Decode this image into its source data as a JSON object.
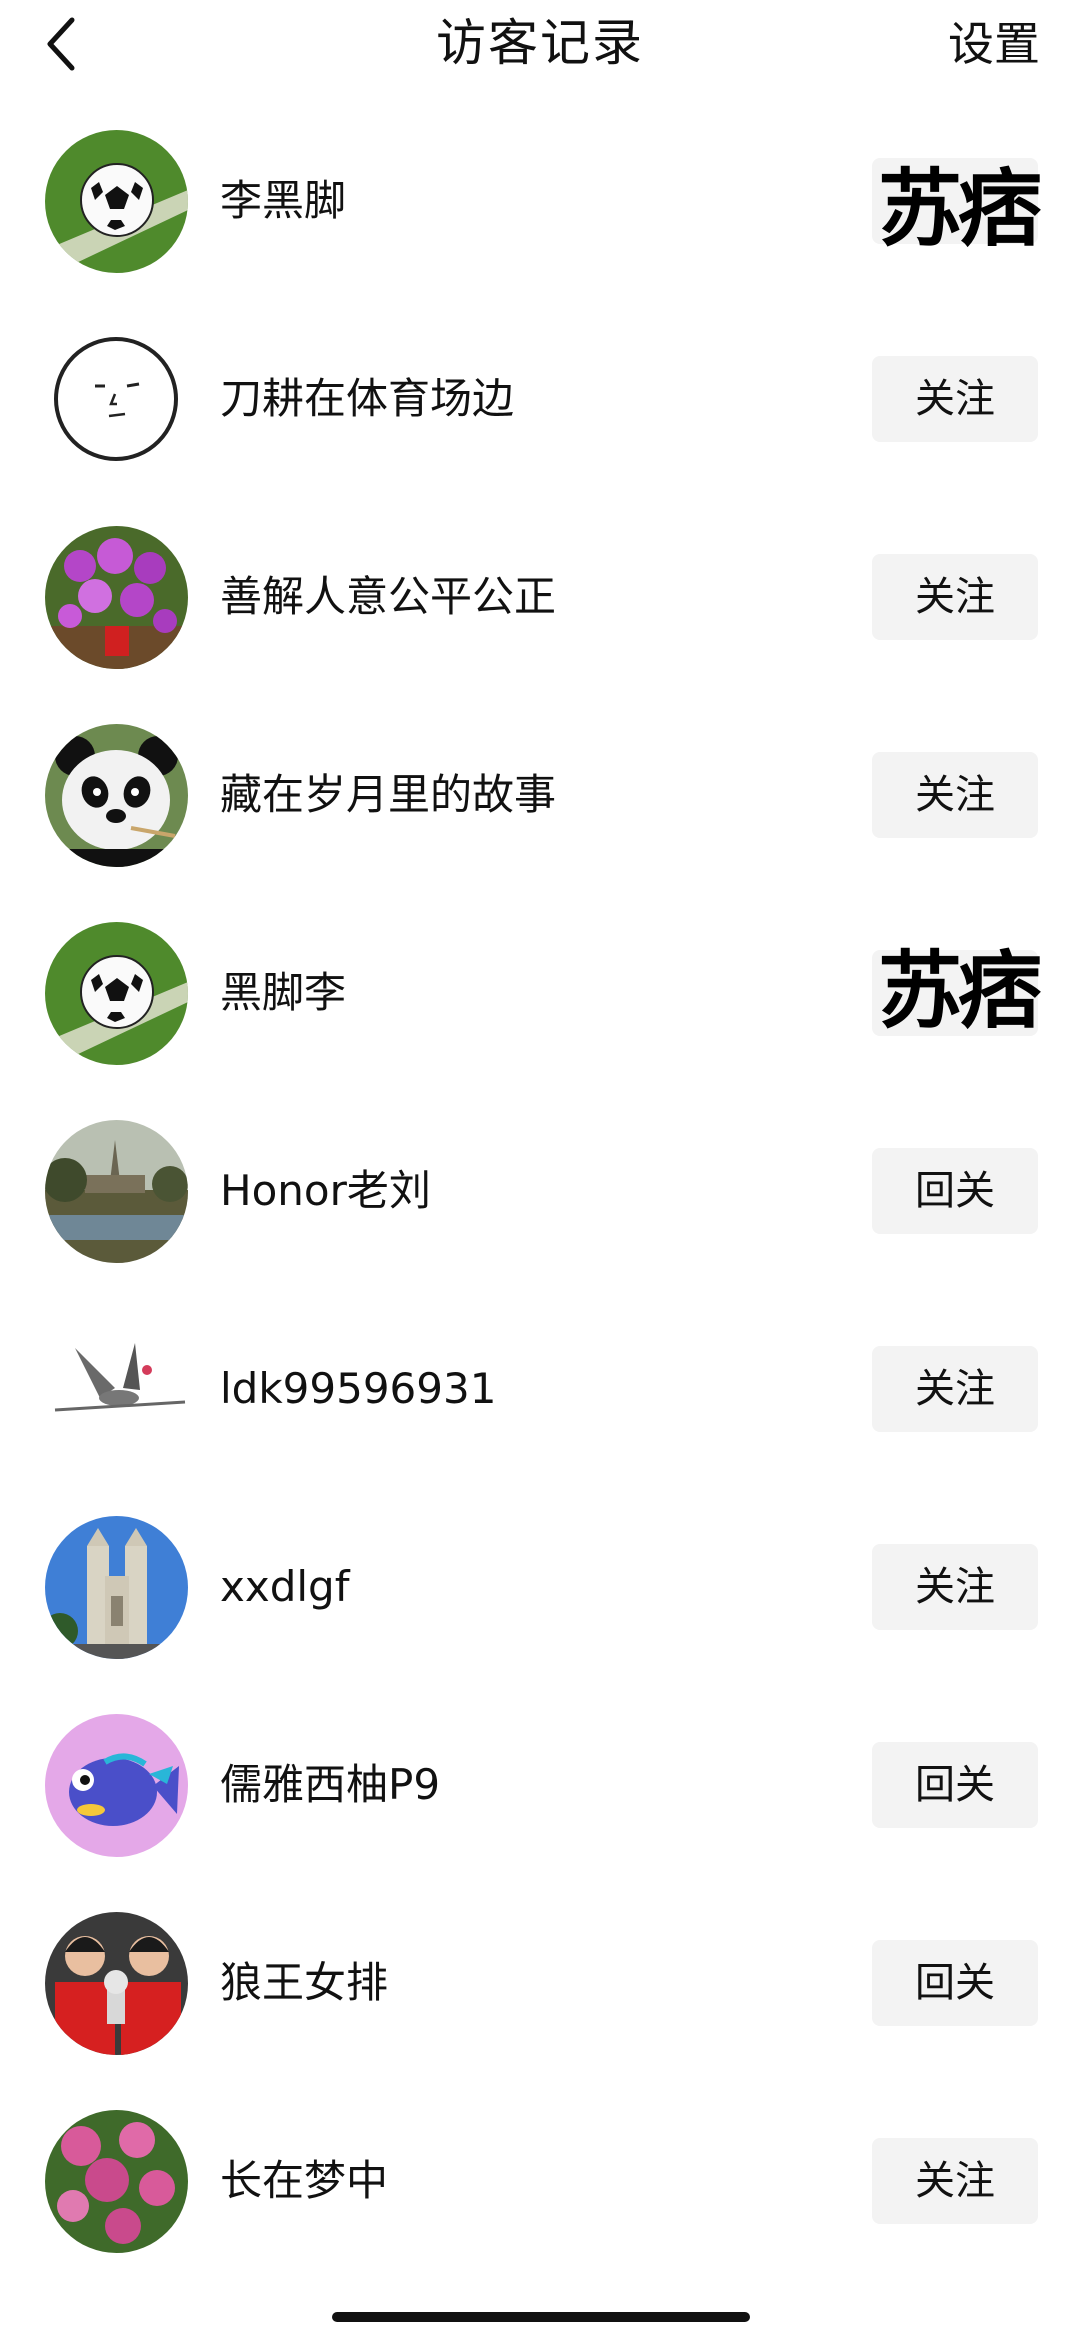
{
  "header": {
    "title": "访客记录",
    "settings_label": "设置"
  },
  "visitors": [
    {
      "name": "李黑脚",
      "avatar": "soccer-ball-avatar",
      "button": "",
      "stamp": "苏痞"
    },
    {
      "name": "刀耕在体育场边",
      "avatar": "face-doodle-avatar",
      "button": "关注"
    },
    {
      "name": "善解人意公平公正",
      "avatar": "orchid-flowers-avatar",
      "button": "关注"
    },
    {
      "name": "藏在岁月里的故事",
      "avatar": "panda-avatar",
      "button": "关注"
    },
    {
      "name": "黑脚李",
      "avatar": "soccer-ball-avatar",
      "button": "",
      "stamp": "苏痞"
    },
    {
      "name": "Honor老刘",
      "avatar": "landscape-painting-avatar",
      "button": "回关"
    },
    {
      "name": "ldk99596931",
      "avatar": "crane-bird-avatar",
      "button": "关注"
    },
    {
      "name": "xxdlgf",
      "avatar": "cathedral-avatar",
      "button": "关注"
    },
    {
      "name": "儒雅西柚P9",
      "avatar": "cartoon-fish-avatar",
      "button": "回关"
    },
    {
      "name": "狼王女排",
      "avatar": "volleyball-players-avatar",
      "button": "回关"
    },
    {
      "name": "长在梦中",
      "avatar": "peony-flowers-avatar",
      "button": "关注"
    }
  ],
  "colors": {
    "button_bg": "#f3f3f3",
    "text": "#111111",
    "background": "#ffffff"
  }
}
